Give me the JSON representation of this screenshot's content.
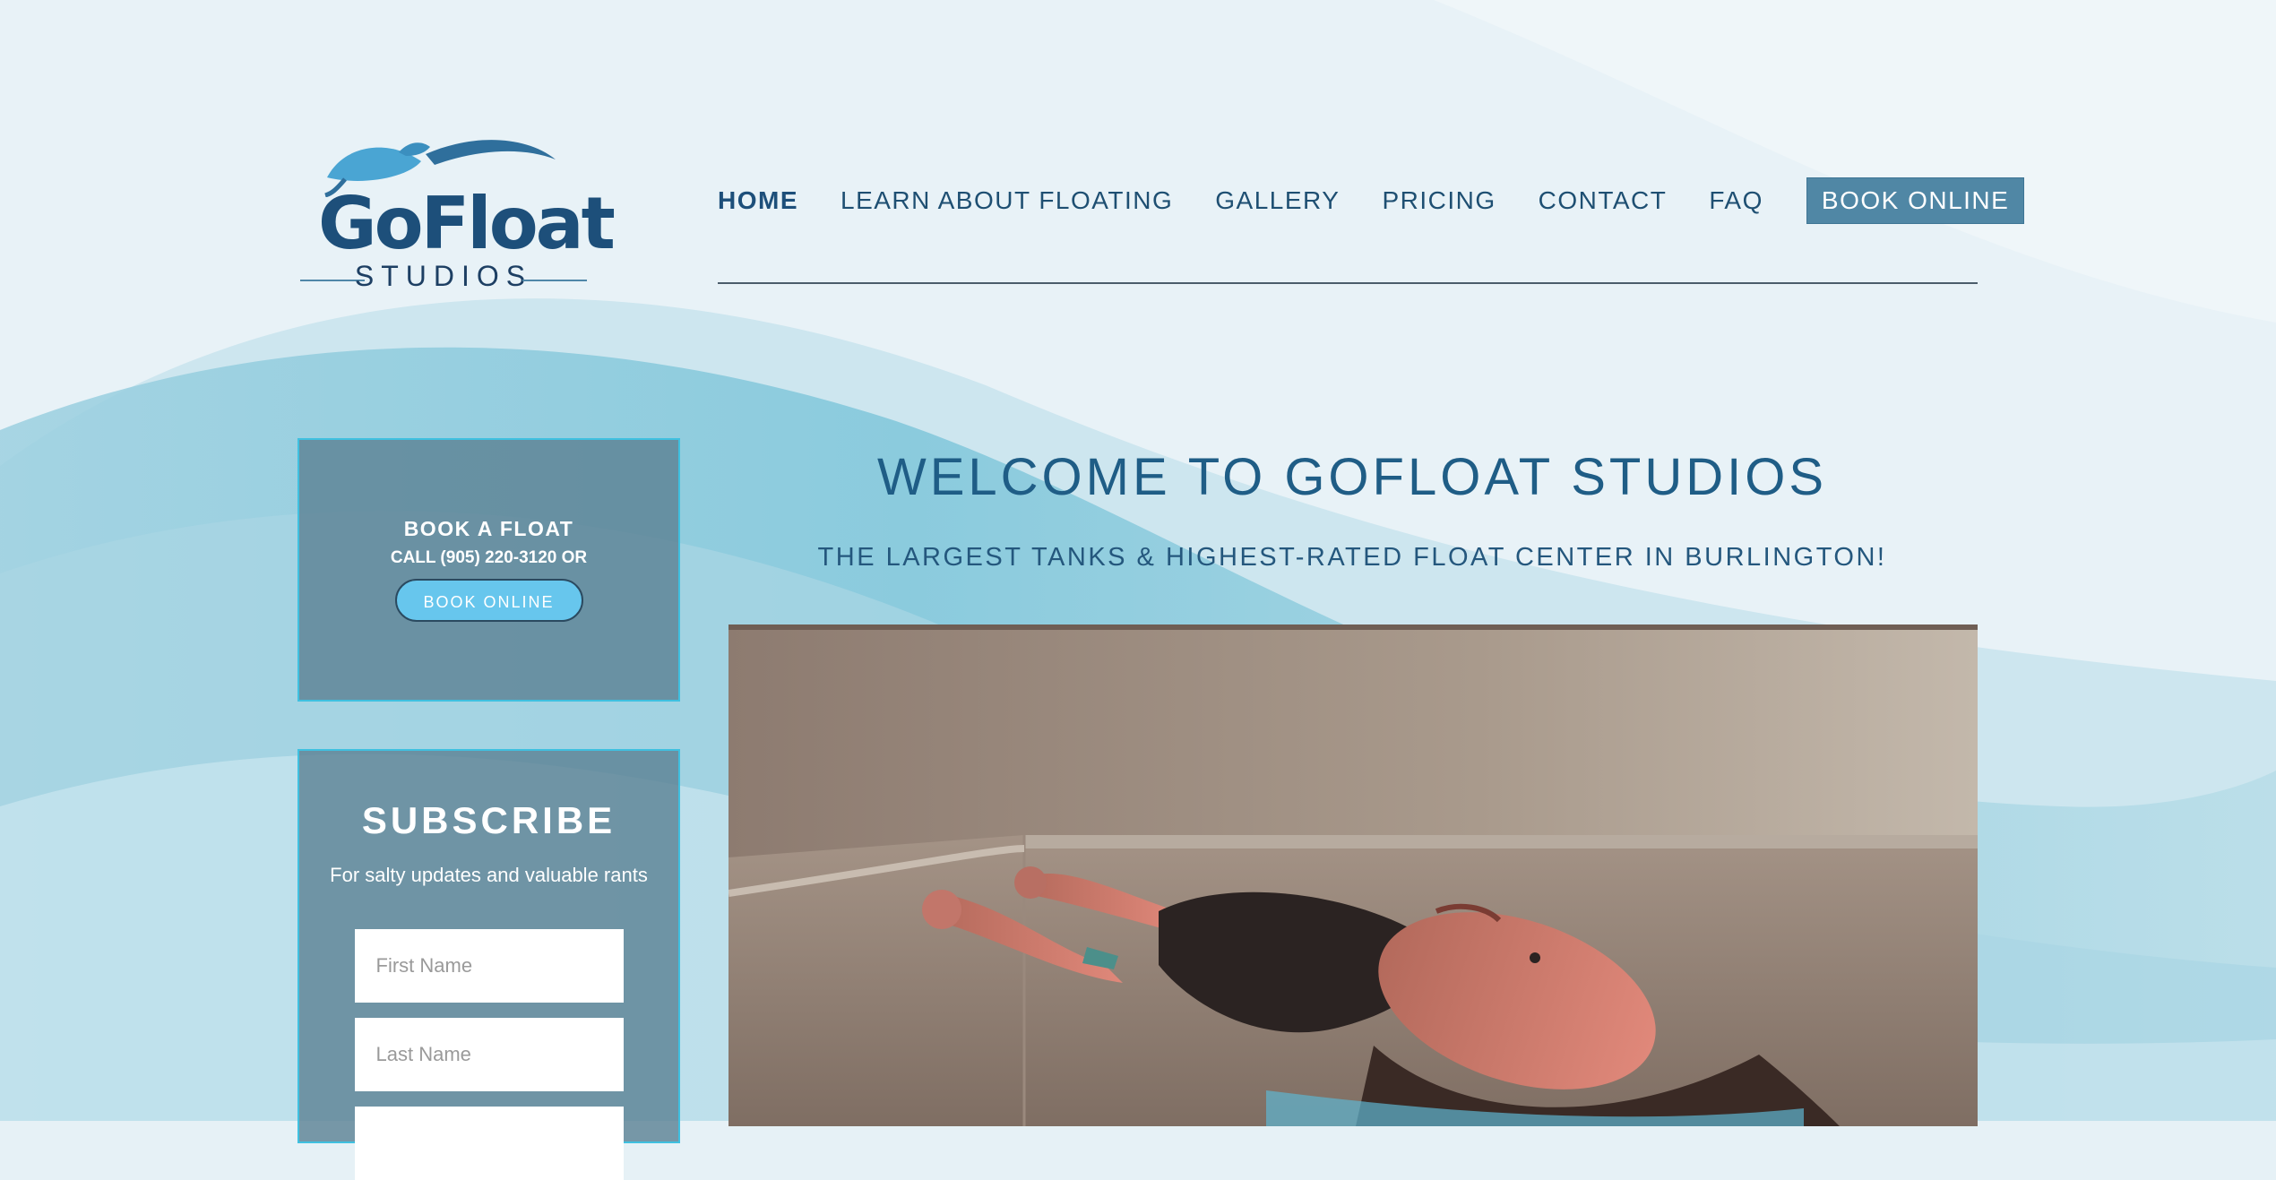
{
  "logo": {
    "brand": "GoFloat",
    "sub": "STUDIOS"
  },
  "nav": {
    "items": [
      {
        "label": "HOME",
        "active": true
      },
      {
        "label": "LEARN ABOUT FLOATING"
      },
      {
        "label": "GALLERY"
      },
      {
        "label": "PRICING"
      },
      {
        "label": "CONTACT"
      },
      {
        "label": "FAQ"
      }
    ],
    "book_label": "BOOK ONLINE"
  },
  "book_box": {
    "title": "BOOK A FLOAT",
    "call": "CALL (905) 220-3120 OR",
    "button": "BOOK ONLINE"
  },
  "subscribe": {
    "heading": "SUBSCRIBE",
    "text": "For salty updates and valuable rants",
    "first_placeholder": "First Name",
    "last_placeholder": "Last Name",
    "email_placeholder": ""
  },
  "main": {
    "welcome": "WELCOME TO GOFLOAT STUDIOS",
    "tagline": "THE LARGEST TANKS & HIGHEST-RATED FLOAT CENTER IN BURLINGTON!"
  },
  "colors": {
    "accent": "#5087a5",
    "nav_text": "#1e4f72",
    "heading": "#1f5d86",
    "box_border": "#3fc0e0",
    "pill": "#67c6ed"
  }
}
